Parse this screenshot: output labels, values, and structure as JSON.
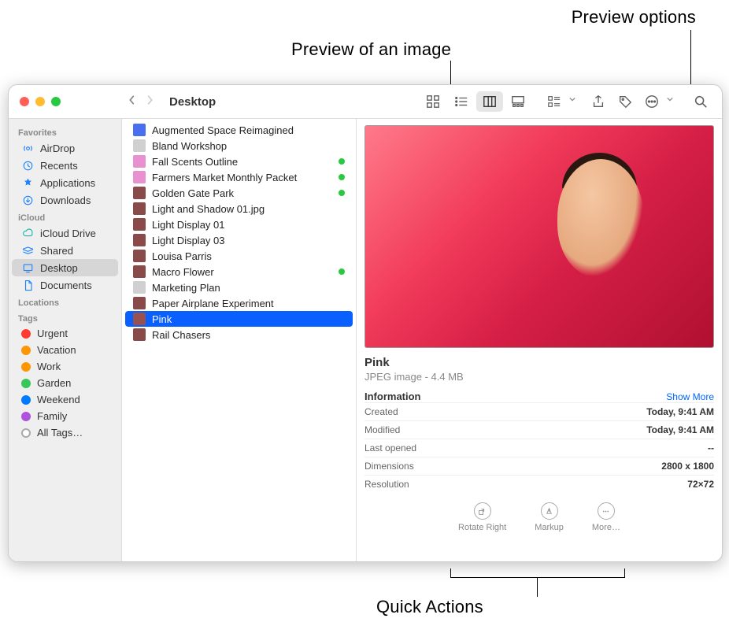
{
  "callouts": {
    "preview_options": "Preview options",
    "preview_image": "Preview of an image",
    "quick_actions": "Quick Actions"
  },
  "toolbar": {
    "location": "Desktop"
  },
  "sidebar": {
    "sections": [
      {
        "title": "Favorites",
        "items": [
          {
            "icon": "airdrop",
            "label": "AirDrop"
          },
          {
            "icon": "recents",
            "label": "Recents"
          },
          {
            "icon": "apps",
            "label": "Applications"
          },
          {
            "icon": "downloads",
            "label": "Downloads"
          }
        ]
      },
      {
        "title": "iCloud",
        "items": [
          {
            "icon": "cloud",
            "label": "iCloud Drive"
          },
          {
            "icon": "shared",
            "label": "Shared"
          },
          {
            "icon": "desktop",
            "label": "Desktop",
            "selected": true
          },
          {
            "icon": "docs",
            "label": "Documents"
          }
        ]
      },
      {
        "title": "Locations",
        "items": []
      },
      {
        "title": "Tags",
        "items": [
          {
            "color": "#ff3b30",
            "label": "Urgent"
          },
          {
            "color": "#ff9500",
            "label": "Vacation"
          },
          {
            "color": "#ff9500",
            "label": "Work"
          },
          {
            "color": "#34c759",
            "label": "Garden"
          },
          {
            "color": "#007aff",
            "label": "Weekend"
          },
          {
            "color": "#af52de",
            "label": "Family"
          },
          {
            "color": null,
            "label": "All Tags…",
            "alltags": true
          }
        ]
      }
    ]
  },
  "filelist": [
    {
      "name": "Augmented Space Reimagined",
      "kind": "keynote"
    },
    {
      "name": "Bland Workshop",
      "kind": "doc"
    },
    {
      "name": "Fall Scents Outline",
      "kind": "text",
      "tagged": true
    },
    {
      "name": "Farmers Market Monthly Packet",
      "kind": "text",
      "tagged": true
    },
    {
      "name": "Golden Gate Park",
      "kind": "image",
      "tagged": true
    },
    {
      "name": "Light and Shadow 01.jpg",
      "kind": "image"
    },
    {
      "name": "Light Display 01",
      "kind": "image"
    },
    {
      "name": "Light Display 03",
      "kind": "image"
    },
    {
      "name": "Louisa Parris",
      "kind": "image"
    },
    {
      "name": "Macro Flower",
      "kind": "image",
      "tagged": true
    },
    {
      "name": "Marketing Plan",
      "kind": "doc"
    },
    {
      "name": "Paper Airplane Experiment",
      "kind": "image"
    },
    {
      "name": "Pink",
      "kind": "image",
      "selected": true
    },
    {
      "name": "Rail Chasers",
      "kind": "image"
    }
  ],
  "preview": {
    "name": "Pink",
    "subtitle": "JPEG image - 4.4 MB",
    "info_title": "Information",
    "show_more": "Show More",
    "rows": [
      {
        "label": "Created",
        "value": "Today, 9:41 AM"
      },
      {
        "label": "Modified",
        "value": "Today, 9:41 AM"
      },
      {
        "label": "Last opened",
        "value": "--"
      },
      {
        "label": "Dimensions",
        "value": "2800 x 1800"
      },
      {
        "label": "Resolution",
        "value": "72×72"
      }
    ],
    "actions": [
      {
        "id": "rotate",
        "label": "Rotate Right"
      },
      {
        "id": "markup",
        "label": "Markup"
      },
      {
        "id": "more",
        "label": "More…"
      }
    ]
  }
}
